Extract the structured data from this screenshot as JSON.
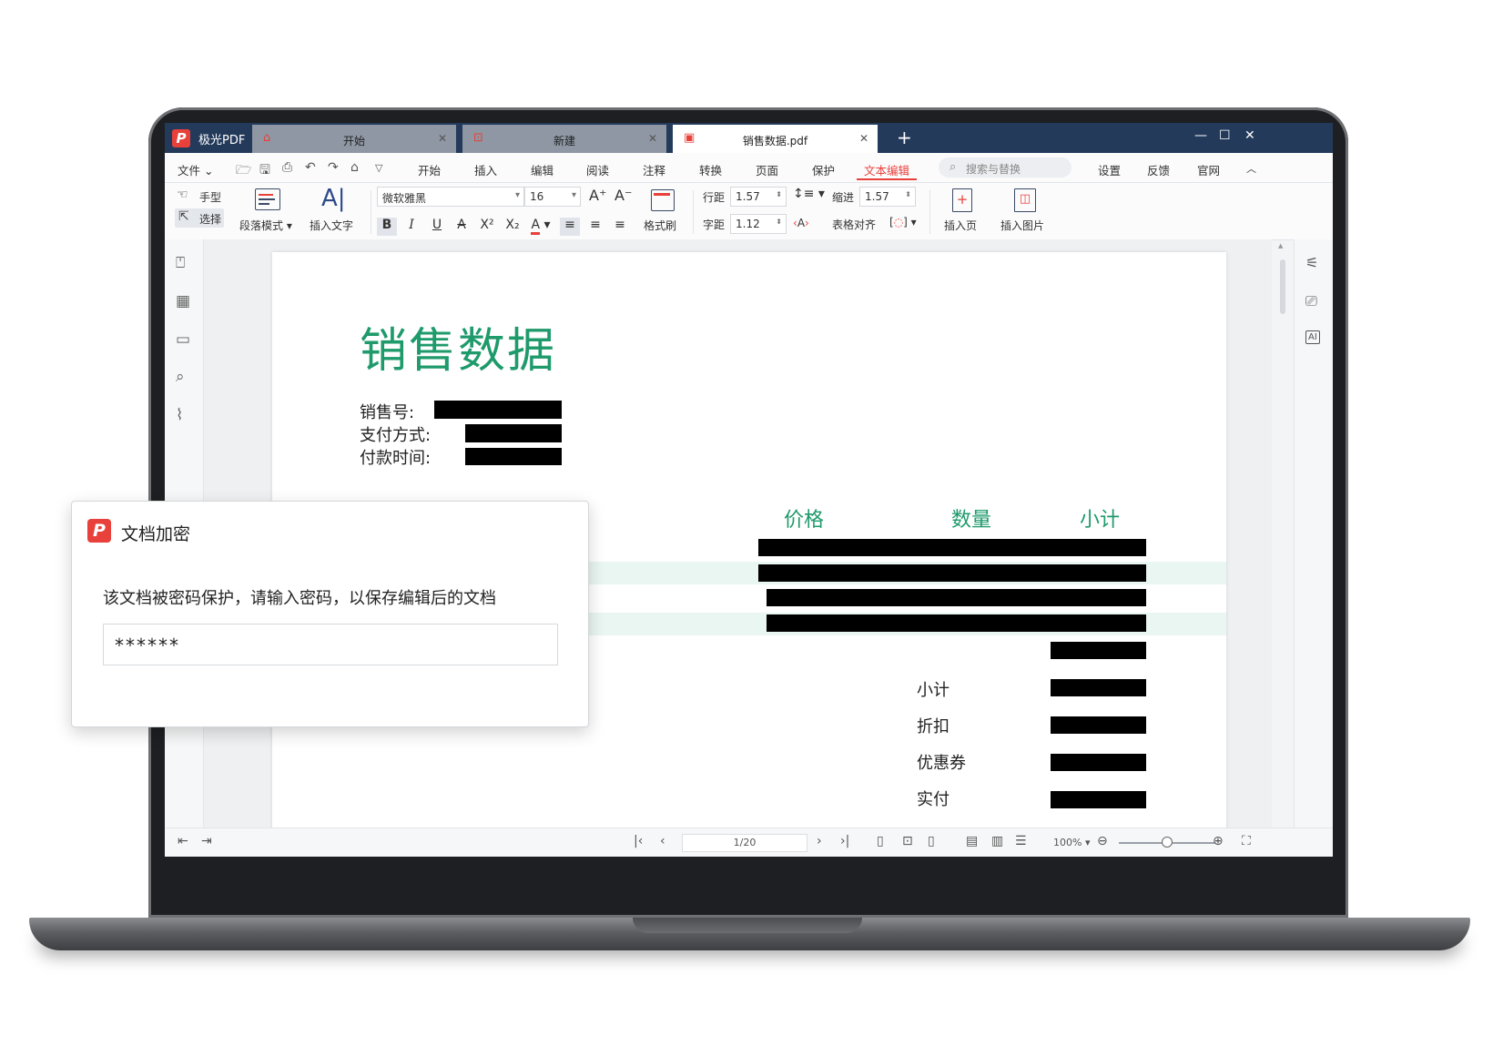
{
  "app": {
    "brand": "极光PDF",
    "tabs": [
      {
        "label": "开始",
        "icon": "home-icon"
      },
      {
        "label": "新建",
        "icon": "new-doc-icon"
      },
      {
        "label": "销售数据.pdf",
        "icon": "pdf-file-icon",
        "active": true
      }
    ],
    "new_tab": "+",
    "window_controls": [
      "minimize-icon",
      "maximize-icon",
      "close-icon"
    ]
  },
  "menu": {
    "file": "文件",
    "items": [
      "开始",
      "插入",
      "编辑",
      "阅读",
      "注释",
      "转换",
      "页面",
      "保护",
      "文本编辑"
    ],
    "active_item": "文本编辑",
    "search_placeholder": "搜索与替换",
    "right_items": [
      "设置",
      "反馈",
      "官网"
    ]
  },
  "toolbar": {
    "hand": "手型",
    "select": "选择",
    "paragraph_mode": "段落模式",
    "insert_text": "插入文字",
    "font_family": "微软雅黑",
    "font_size": "16",
    "format_painter": "格式刷",
    "line_spacing_label": "行距",
    "line_spacing_value": "1.57",
    "char_spacing_label": "字距",
    "char_spacing_value": "1.12",
    "indent_label": "缩进",
    "indent_value": "1.57",
    "table_align": "表格对齐",
    "insert_page": "插入页",
    "insert_image": "插入图片"
  },
  "document": {
    "title": "销售数据",
    "fields": [
      "销售号:",
      "支付方式:",
      "付款时间:"
    ],
    "columns": [
      "价格",
      "数量",
      "小计"
    ],
    "summary": [
      "小计",
      "折扣",
      "优惠券",
      "实付"
    ]
  },
  "status": {
    "page": "1/20",
    "zoom": "100%"
  },
  "dialog": {
    "title": "文档加密",
    "message": "该文档被密码保护，请输入密码，以保存编辑后的文档",
    "password": "******"
  },
  "colors": {
    "accent": "#e8403a",
    "titlebar": "#233a5b",
    "doc_green": "#1e9a6b"
  }
}
